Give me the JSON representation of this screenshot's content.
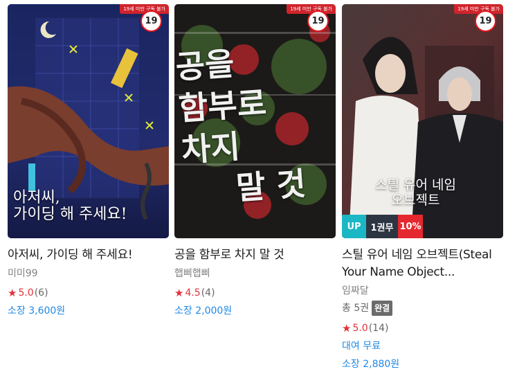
{
  "books": [
    {
      "title": "아저씨, 가이딩 해 주세요!",
      "author": "미미99",
      "age_rating": "19",
      "warning": "19세 미만 구독 불가",
      "cover_title_line1": "아저씨,",
      "cover_title_line2": "가이딩 해 주세요!",
      "rating": "5.0",
      "rating_count": "(6)",
      "price": "소장 3,600원"
    },
    {
      "title": "공을 함부로 차지 말 것",
      "author": "햅삐햅삐",
      "age_rating": "19",
      "warning": "19세 미만 구독 불가",
      "cover_title_lines": [
        "공을",
        "함부로",
        "차지",
        "말 것"
      ],
      "rating": "4.5",
      "rating_count": "(4)",
      "price": "소장 2,000원"
    },
    {
      "title": "스틸 유어 네임 오브젝트(Steal Your Name Object...",
      "author": "임짜달",
      "age_rating": "19",
      "warning": "19세 미만 구독 불가",
      "cover_title_line1": "스틸 유어 네임",
      "cover_title_line2": "오브젝트",
      "volumes": "총 5권",
      "complete": "완결",
      "tags": {
        "up": "UP",
        "volume": "1권무",
        "discount": "10%"
      },
      "rating": "5.0",
      "rating_count": "(14)",
      "rent": "대여 무료",
      "price": "소장 2,880원"
    }
  ],
  "colors": {
    "accent_blue": "#1e88e5",
    "star_red": "#e0303a",
    "badge_red": "#e0141e"
  },
  "icons": {
    "rating": "star-icon"
  }
}
